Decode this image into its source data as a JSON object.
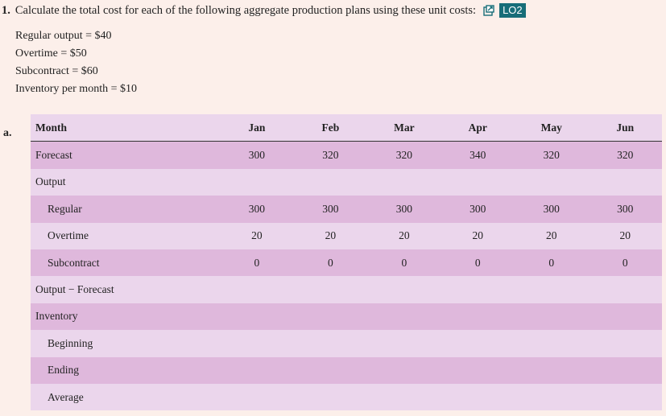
{
  "question": {
    "number": "1.",
    "text": "Calculate the total cost for each of the following aggregate production plans using these unit costs:",
    "lo_badge": "LO2"
  },
  "unit_costs": [
    "Regular output = $40",
    "Overtime = $50",
    "Subcontract = $60",
    "Inventory per month = $10"
  ],
  "part_label": "a.",
  "table": {
    "header_label": "Month",
    "months": [
      "Jan",
      "Feb",
      "Mar",
      "Apr",
      "May",
      "Jun"
    ],
    "rows": [
      {
        "label": "Forecast",
        "indent": false,
        "values": [
          "300",
          "320",
          "320",
          "340",
          "320",
          "320"
        ]
      },
      {
        "label": "Output",
        "indent": false,
        "values": [
          "",
          "",
          "",
          "",
          "",
          ""
        ]
      },
      {
        "label": "Regular",
        "indent": true,
        "values": [
          "300",
          "300",
          "300",
          "300",
          "300",
          "300"
        ]
      },
      {
        "label": "Overtime",
        "indent": true,
        "values": [
          "20",
          "20",
          "20",
          "20",
          "20",
          "20"
        ]
      },
      {
        "label": "Subcontract",
        "indent": true,
        "values": [
          "0",
          "0",
          "0",
          "0",
          "0",
          "0"
        ]
      },
      {
        "label": "Output − Forecast",
        "indent": false,
        "values": [
          "",
          "",
          "",
          "",
          "",
          ""
        ]
      },
      {
        "label": "Inventory",
        "indent": false,
        "values": [
          "",
          "",
          "",
          "",
          "",
          ""
        ]
      },
      {
        "label": "Beginning",
        "indent": true,
        "values": [
          "",
          "",
          "",
          "",
          "",
          ""
        ]
      },
      {
        "label": "Ending",
        "indent": true,
        "values": [
          "",
          "",
          "",
          "",
          "",
          ""
        ]
      },
      {
        "label": "Average",
        "indent": true,
        "values": [
          "",
          "",
          "",
          "",
          "",
          ""
        ]
      }
    ]
  }
}
